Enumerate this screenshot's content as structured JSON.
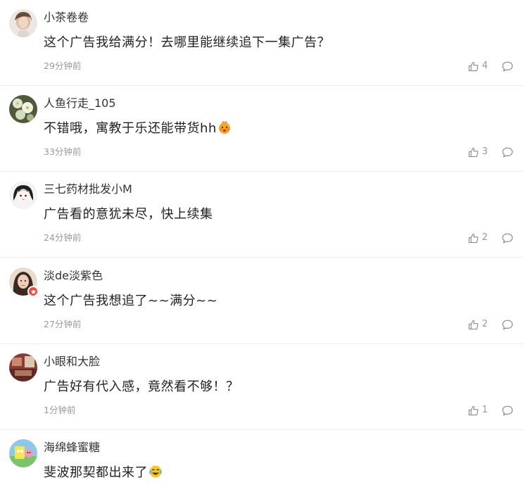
{
  "comments": [
    {
      "username": "小茶卷卷",
      "text": "这个广告我给满分！去哪里能继续追下一集广告？",
      "time": "29分钟前",
      "likes": "4",
      "avatar": "girl-portrait-avatar"
    },
    {
      "username": "人鱼行走_105",
      "text": "不错哦，寓教于乐还能带货hh",
      "emoji": "hot-face-emoji",
      "time": "33分钟前",
      "likes": "3",
      "avatar": "flower-photo-avatar"
    },
    {
      "username": "三七药材批发小M",
      "text": "广告看的意犹未尽，快上续集",
      "time": "24分钟前",
      "likes": "2",
      "avatar": "cartoon-girl-avatar"
    },
    {
      "username": "淡de淡紫色",
      "text": "这个广告我想追了~~满分~~",
      "time": "27分钟前",
      "likes": "2",
      "avatar": "woman-portrait-avatar",
      "badge": "verified-badge-icon"
    },
    {
      "username": "小眼和大脸",
      "text": "广告好有代入感，竟然看不够！？",
      "time": "1分钟前",
      "likes": "1",
      "avatar": "room-photo-avatar"
    },
    {
      "username": "海绵蜂蜜糖",
      "text": "斐波那契都出来了",
      "emoji": "laughing-tears-emoji",
      "time": "",
      "likes": "",
      "avatar": "cartoon-scene-avatar"
    }
  ],
  "colors": {
    "username": "#333333",
    "content": "#222222",
    "meta": "#999999",
    "divider": "#ececec",
    "badge": "#e94b3c"
  },
  "icons": {
    "like": "thumbs-up-icon",
    "reply": "speech-bubble-icon"
  }
}
